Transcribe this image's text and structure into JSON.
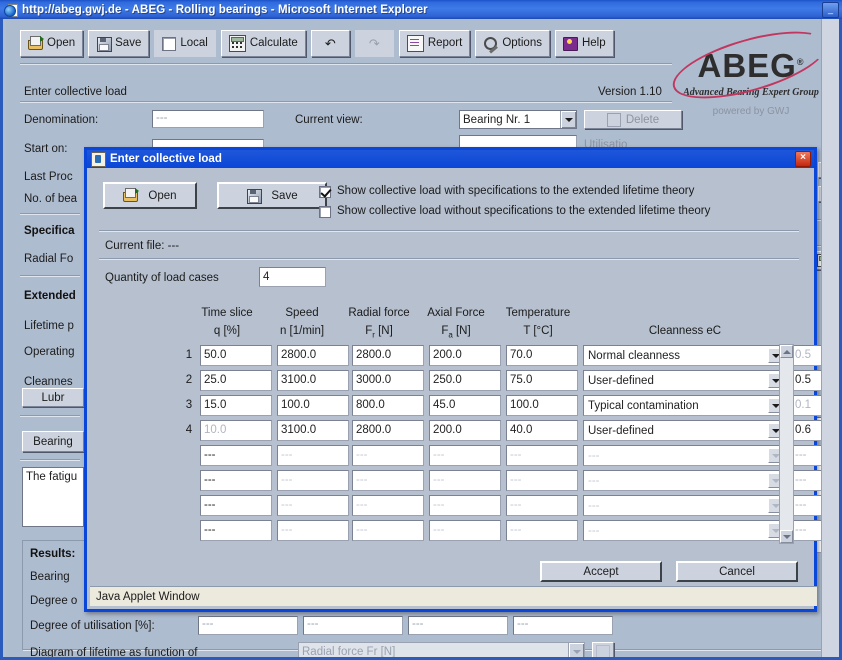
{
  "window": {
    "title": "http://abeg.gwj.de - ABEG - Rolling bearings - Microsoft Internet Explorer",
    "minimize_label": "_"
  },
  "toolbar": {
    "open": "Open",
    "save": "Save",
    "local": "Local",
    "calculate": "Calculate",
    "undo": "↶",
    "redo": "↷",
    "report": "Report",
    "options": "Options",
    "help": "Help"
  },
  "header": {
    "page_title": "Enter collective load",
    "version": "Version  1.10"
  },
  "logo": {
    "name": "ABEG",
    "tm": "®",
    "tagline": "Advanced Bearing Expert Group",
    "powered": "powered by GWJ"
  },
  "form": {
    "denomination_label": "Denomination:",
    "denomination_value": "---",
    "start_on_label": "Start on:",
    "last_proc_label": "Last Proc",
    "no_of_bearings_label": "No. of bea",
    "specification_label": "Specifica",
    "radial_force_label": "Radial Fo",
    "extended_label": "Extended",
    "lifetime_label": "Lifetime p",
    "operating_label": "Operating",
    "cleanness_label": "Cleannes",
    "lubrication_button": "Lubr",
    "bearing_button": "Bearing",
    "note_text": "The fatigu",
    "current_view_label": "Current view:",
    "current_view_value": "Bearing Nr. 1",
    "delete_button": "Delete",
    "utilisation_partial": "Utilisatio"
  },
  "results": {
    "title": "Results:",
    "bearing_label": "Bearing",
    "degree_label": "Degree o",
    "degree_utilisation_label": "Degree of utilisation [%]:",
    "degree_values": [
      "---",
      "---",
      "---",
      "---"
    ],
    "diagram_label": "Diagram of lifetime as function of",
    "diagram_value": "Radial force Fr [N]"
  },
  "dialog": {
    "title": "Enter collective load",
    "close_label": "×",
    "open_button": "Open",
    "save_button": "Save",
    "checkbox_with": {
      "label": "Show collective load with specifications to the extended lifetime theory",
      "checked": true
    },
    "checkbox_without": {
      "label": "Show collective load without specifications to the extended lifetime theory",
      "checked": false
    },
    "current_file_label": "Current file: ---",
    "quantity_label": "Quantity of load cases",
    "quantity_value": "4",
    "columns": [
      {
        "top": "Time slice",
        "bottom": "q [%]"
      },
      {
        "top": "Speed",
        "bottom": "n [1/min]"
      },
      {
        "top": "Radial force",
        "bottom": "F",
        "bottom_sub": "r",
        "bottom_tail": " [N]"
      },
      {
        "top": "Axial Force",
        "bottom": "F",
        "bottom_sub": "a",
        "bottom_tail": " [N]"
      },
      {
        "top": "Temperature",
        "bottom": "T [°C]"
      },
      {
        "top": "",
        "bottom": "Cleanness eC"
      }
    ],
    "rows": [
      {
        "n": "1",
        "q": "50.0",
        "speed": "2800.0",
        "fr": "2800.0",
        "fa": "200.0",
        "temp": "70.0",
        "cleanness": "Normal cleanness",
        "ec": "0.5",
        "ec_disabled": true,
        "q_disabled": false
      },
      {
        "n": "2",
        "q": "25.0",
        "speed": "3100.0",
        "fr": "3000.0",
        "fa": "250.0",
        "temp": "75.0",
        "cleanness": "User-defined",
        "ec": "0.5",
        "ec_disabled": false,
        "q_disabled": false
      },
      {
        "n": "3",
        "q": "15.0",
        "speed": "100.0",
        "fr": "800.0",
        "fa": "45.0",
        "temp": "100.0",
        "cleanness": "Typical contamination",
        "ec": "0.1",
        "ec_disabled": true,
        "q_disabled": false
      },
      {
        "n": "4",
        "q": "10.0",
        "speed": "3100.0",
        "fr": "2800.0",
        "fa": "200.0",
        "temp": "40.0",
        "cleanness": "User-defined",
        "ec": "0.6",
        "ec_disabled": false,
        "q_disabled": true
      },
      {
        "n": "",
        "q": "---",
        "speed": "---",
        "fr": "---",
        "fa": "---",
        "temp": "---",
        "cleanness": "---",
        "ec": "---",
        "empty": true
      },
      {
        "n": "",
        "q": "---",
        "speed": "---",
        "fr": "---",
        "fa": "---",
        "temp": "---",
        "cleanness": "---",
        "ec": "---",
        "empty": true
      },
      {
        "n": "",
        "q": "---",
        "speed": "---",
        "fr": "---",
        "fa": "---",
        "temp": "---",
        "cleanness": "---",
        "ec": "---",
        "empty": true
      },
      {
        "n": "",
        "q": "---",
        "speed": "---",
        "fr": "---",
        "fa": "---",
        "temp": "---",
        "cleanness": "---",
        "ec": "---",
        "empty": true
      }
    ],
    "accept_button": "Accept",
    "cancel_button": "Cancel",
    "status": "Java Applet Window"
  },
  "colors": {
    "title_blue": "#0a46d8",
    "ie_blue": "#2f6bdd",
    "dialog_bg": "#b6c0cf",
    "page_bg": "#aebccf",
    "accent_red": "#c2375f",
    "status_bg": "#ece9dd"
  }
}
